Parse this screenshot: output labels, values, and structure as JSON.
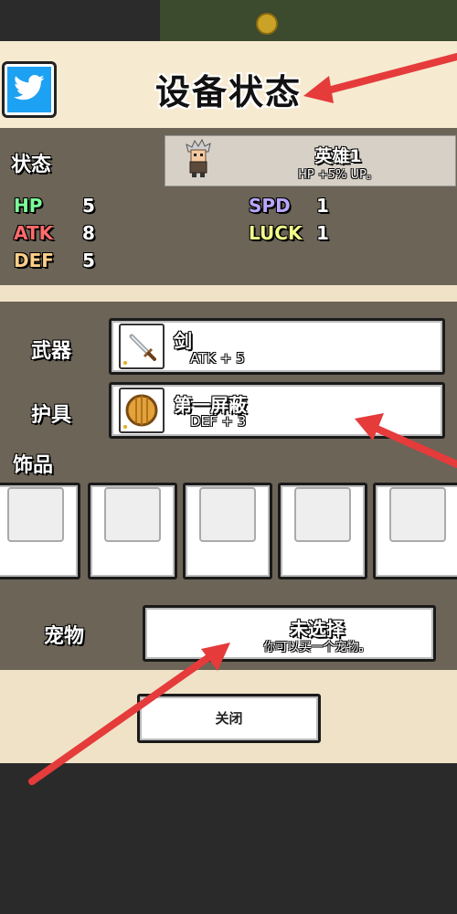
{
  "title": "设备状态",
  "status": {
    "heading": "状态",
    "stats": [
      {
        "name": "HP",
        "value": "5",
        "color": "#7dff9a"
      },
      {
        "name": "ATK",
        "value": "8",
        "color": "#ff6b6b"
      },
      {
        "name": "DEF",
        "value": "5",
        "color": "#ffcf8a"
      },
      {
        "name": "SPD",
        "value": "1",
        "color": "#b9a7ff"
      },
      {
        "name": "LUCK",
        "value": "1",
        "color": "#f2ff8a"
      }
    ],
    "hero": {
      "name": "英雄1",
      "bonus": "HP +5% UP。"
    }
  },
  "equipment": {
    "weapon": {
      "label": "武器",
      "item_name": "剑",
      "item_stat": "ATK + 5"
    },
    "armor": {
      "label": "护具",
      "item_name": "第一屏蔽",
      "item_stat": "DEF + 3"
    },
    "accessory": {
      "label": "饰品",
      "slots": 5
    },
    "pet": {
      "label": "宠物",
      "value": "未选择",
      "hint": "你可以买一个宠物。"
    }
  },
  "close_button": "关闭",
  "icons": {
    "share": "twitter-icon",
    "weapon": "sword-icon",
    "armor": "shield-icon",
    "hero": "hero-avatar-icon"
  },
  "colors": {
    "panel_bg": "#efe2c6",
    "section_bg": "#6c6457",
    "arrow": "#e53b3b"
  }
}
